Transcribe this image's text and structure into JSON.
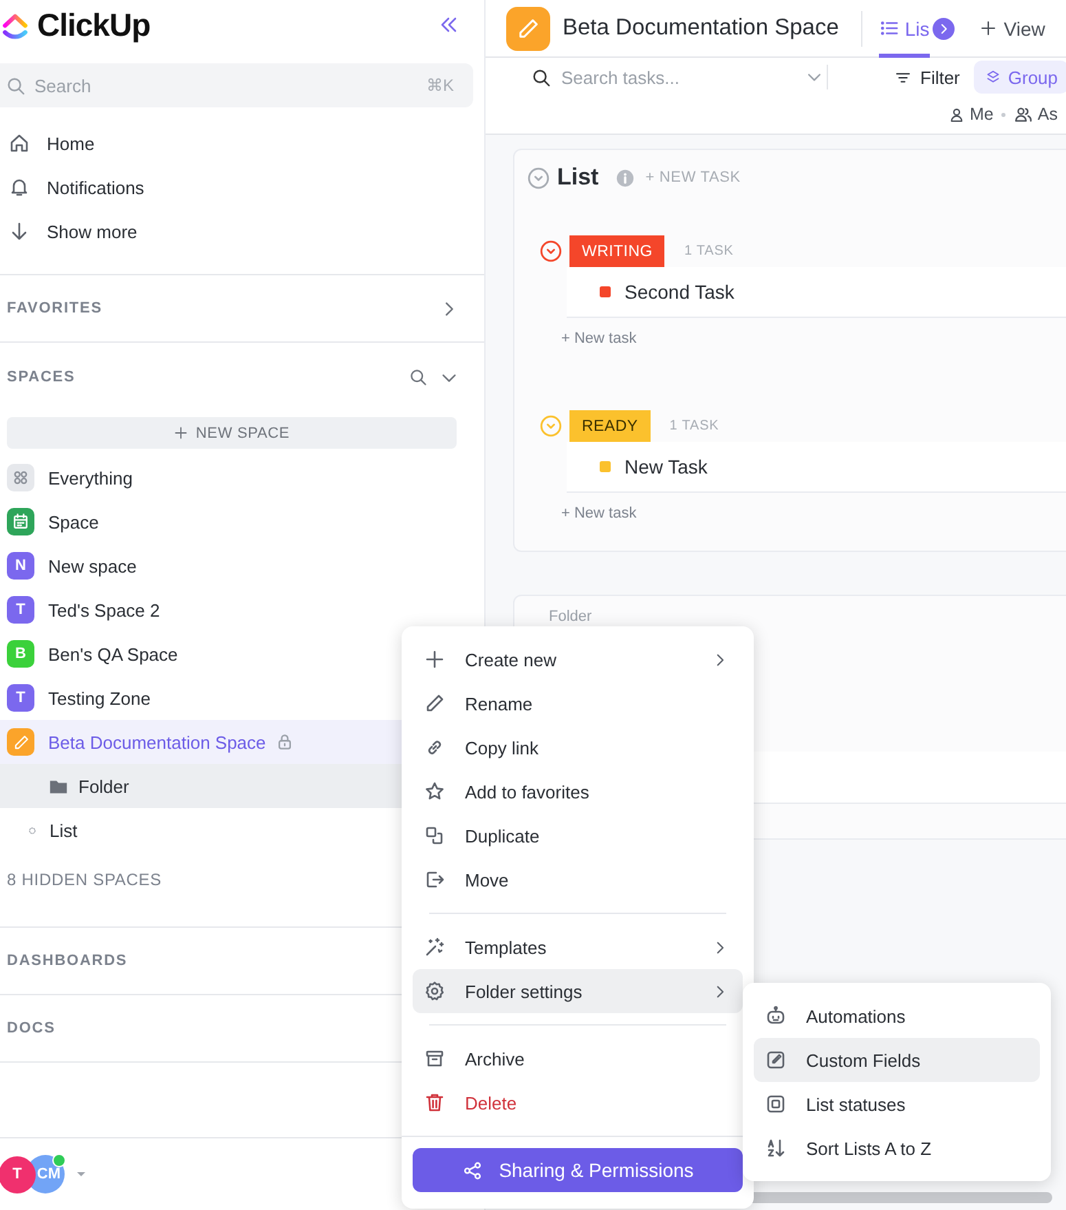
{
  "sidebar": {
    "logo": "ClickUp",
    "search": {
      "placeholder": "Search",
      "shortcut": "⌘K"
    },
    "nav": [
      {
        "label": "Home"
      },
      {
        "label": "Notifications"
      },
      {
        "label": "Show more"
      }
    ],
    "favorites": {
      "title": "FAVORITES"
    },
    "spaces": {
      "title": "SPACES",
      "new_space": "NEW SPACE",
      "items": [
        {
          "kind": "all",
          "label": "Everything",
          "color": "#e6e8ec",
          "selected": false,
          "locked": false
        },
        {
          "kind": "calendar",
          "label": "Space",
          "color": "#2ea55a",
          "selected": false,
          "locked": false
        },
        {
          "kind": "letter",
          "badge": "N",
          "label": "New space",
          "color": "#7b68ee",
          "selected": false,
          "locked": false
        },
        {
          "kind": "letter",
          "badge": "T",
          "label": "Ted's Space 2",
          "color": "#7b68ee",
          "selected": false,
          "locked": false
        },
        {
          "kind": "letter",
          "badge": "B",
          "label": "Ben's QA Space",
          "color": "#3bd13b",
          "selected": false,
          "locked": false
        },
        {
          "kind": "letter",
          "badge": "T",
          "label": "Testing Zone",
          "color": "#7b68ee",
          "selected": false,
          "locked": false
        },
        {
          "kind": "pencil",
          "label": "Beta Documentation Space",
          "color": "#fba42a",
          "selected": true,
          "locked": true,
          "children": [
            {
              "kind": "folder",
              "label": "Folder",
              "selected": true
            },
            {
              "kind": "list",
              "label": "List",
              "selected": false
            }
          ]
        }
      ]
    },
    "hidden_spaces": "8 HIDDEN SPACES",
    "dashboards": {
      "title": "DASHBOARDS"
    },
    "docs": {
      "title": "DOCS"
    },
    "avatars": [
      {
        "initials": "T",
        "color": "#f0306e",
        "online": false
      },
      {
        "initials": "CM",
        "color": "#72a4f6",
        "online": true
      }
    ]
  },
  "main": {
    "header": {
      "title": "Beta Documentation Space",
      "tabs": [
        {
          "label": "Lis",
          "selected": true
        }
      ],
      "add_view": "View"
    },
    "toolbar": {
      "search_placeholder": "Search tasks...",
      "filter": "Filter",
      "group": "Group",
      "me": "Me",
      "assignees": "As"
    },
    "list": {
      "title": "List",
      "new_task": "+ NEW TASK",
      "groups": [
        {
          "status": "WRITING",
          "color": "#f4462a",
          "count": "1 TASK",
          "tasks": [
            {
              "name": "Second Task"
            }
          ],
          "new_task": "+ New task"
        },
        {
          "status": "READY",
          "color": "#fbc12d",
          "count": "1 TASK",
          "tasks": [
            {
              "name": "New Task"
            }
          ],
          "new_task": "+ New task"
        }
      ]
    },
    "folder": {
      "title": "Folder"
    }
  },
  "context_menu": {
    "sections": [
      [
        {
          "label": "Create new",
          "submenu": true,
          "selected": false,
          "danger": false
        },
        {
          "label": "Rename",
          "submenu": false,
          "selected": false,
          "danger": false
        },
        {
          "label": "Copy link",
          "submenu": false,
          "selected": false,
          "danger": false
        },
        {
          "label": "Add to favorites",
          "submenu": false,
          "selected": false,
          "danger": false
        },
        {
          "label": "Duplicate",
          "submenu": false,
          "selected": false,
          "danger": false
        },
        {
          "label": "Move",
          "submenu": false,
          "selected": false,
          "danger": false
        }
      ],
      [
        {
          "label": "Templates",
          "submenu": true,
          "selected": false,
          "danger": false
        },
        {
          "label": "Folder settings",
          "submenu": true,
          "selected": true,
          "danger": false
        }
      ],
      [
        {
          "label": "Archive",
          "submenu": false,
          "selected": false,
          "danger": false
        },
        {
          "label": "Delete",
          "submenu": false,
          "selected": false,
          "danger": true
        }
      ]
    ],
    "share_button": "Sharing & Permissions"
  },
  "submenu": {
    "items": [
      {
        "label": "Automations",
        "selected": false
      },
      {
        "label": "Custom Fields",
        "selected": true
      },
      {
        "label": "List statuses",
        "selected": false
      },
      {
        "label": "Sort Lists A to Z",
        "selected": false
      }
    ]
  }
}
